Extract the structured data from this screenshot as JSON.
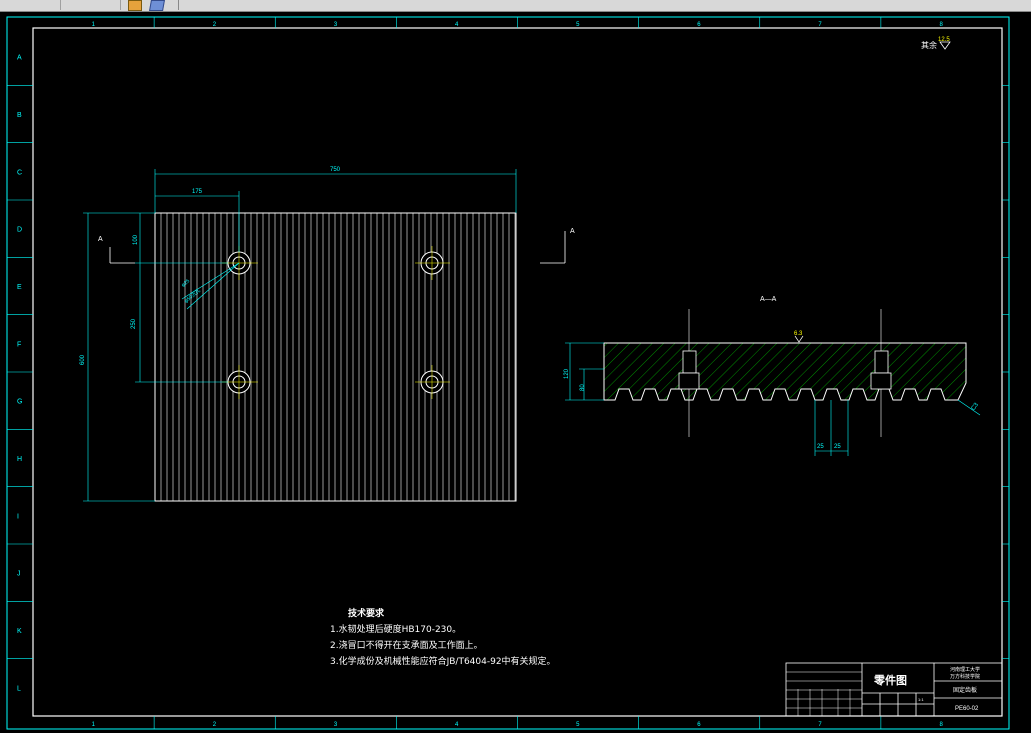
{
  "frame": {
    "col_labels": [
      "1",
      "2",
      "3",
      "4",
      "5",
      "6",
      "7",
      "8"
    ],
    "row_labels": [
      "A",
      "B",
      "C",
      "D",
      "E",
      "F",
      "G",
      "H",
      "I",
      "J",
      "K",
      "L"
    ]
  },
  "drawing": {
    "roughness_label": "其余",
    "roughness_value": "12.5",
    "section_mark": "A",
    "section_title": "A—A",
    "dims": {
      "overall_width": "750",
      "offset_left": "175",
      "overall_height": "600",
      "top_offset": "100",
      "hole_spacing": "250",
      "hole_dia1": "φ25",
      "hole_dia2": "φ50沉孔",
      "thickness": "120",
      "inner_height": "80",
      "slot_w1": "25",
      "slot_w2": "25",
      "chamfer": "C3",
      "surf_value": "6.3"
    }
  },
  "notes": {
    "title": "技术要求",
    "items": [
      "1.水韧处理后硬度HB170-230。",
      "2.浇冒口不得开在支承面及工作面上。",
      "3.化学成份及机械性能应符合JB/T6404-92中有关规定。"
    ]
  },
  "title_block": {
    "drawing_name": "零件图",
    "school": "河南理工大学",
    "dept": "万方科技学院",
    "part_name": "固定齿板",
    "drawing_no": "PE60-02",
    "scale": "1:1"
  },
  "colors": {
    "frame": "#00ffff",
    "geometry": "#ffffff",
    "dimension": "#00ffff",
    "hatch": "#00cc00",
    "section_line": "#ffff00"
  }
}
